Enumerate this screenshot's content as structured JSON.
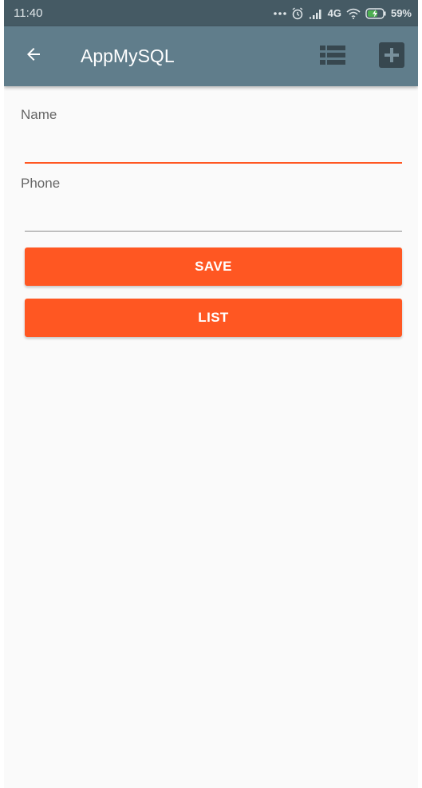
{
  "status_bar": {
    "time": "11:40",
    "network": "4G",
    "battery": "59%",
    "icons": [
      "more-dots-icon",
      "alarm-icon",
      "signal-icon",
      "wifi-icon",
      "battery-charging-icon"
    ]
  },
  "toolbar": {
    "title": "AppMySQL",
    "back_icon": "arrow-back-icon",
    "list_icon": "list-icon",
    "add_icon": "add-box-icon"
  },
  "form": {
    "name": {
      "label": "Name",
      "value": ""
    },
    "phone": {
      "label": "Phone",
      "value": ""
    }
  },
  "buttons": {
    "save": "SAVE",
    "list": "LIST"
  },
  "colors": {
    "status_bar": "#455a64",
    "toolbar": "#607d8b",
    "accent": "#ff5722",
    "background": "#fafafa"
  }
}
